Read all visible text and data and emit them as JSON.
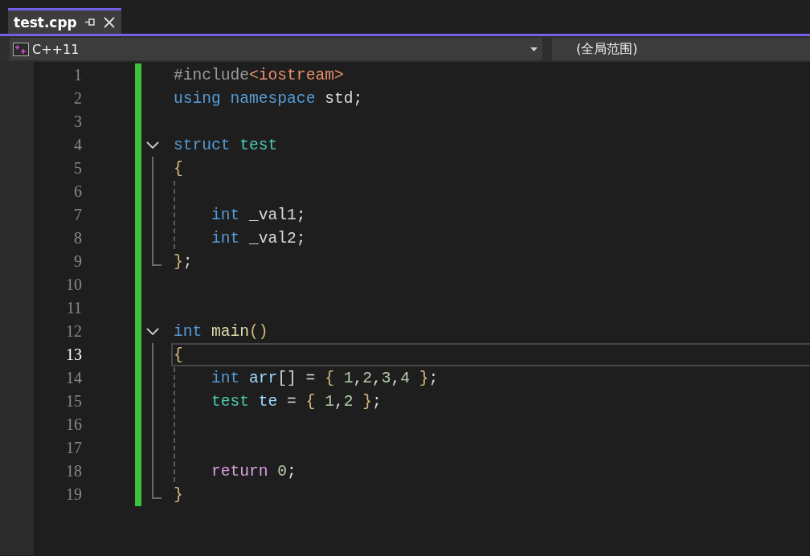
{
  "tabs": [
    {
      "label": "test.cpp",
      "selected": true
    }
  ],
  "nav_bar": {
    "project": "C++11",
    "scope": "(全局范围)"
  },
  "lines": [
    {
      "number": "1",
      "tokens": [
        {
          "text": "#include",
          "kind": "preprocessor"
        },
        {
          "text": "<iostream>",
          "kind": "string"
        }
      ]
    },
    {
      "number": "2",
      "tokens": [
        {
          "text": "using ",
          "kind": "keyword"
        },
        {
          "text": "namespace ",
          "kind": "keyword"
        },
        {
          "text": "std;",
          "kind": "plain"
        }
      ]
    },
    {
      "number": "3"
    },
    {
      "number": "4",
      "expanded": true,
      "tokens": [
        {
          "text": "struct ",
          "kind": "keyword"
        },
        {
          "text": "test",
          "kind": "type"
        }
      ],
      "children": [
        {
          "number": "5",
          "tokens": [
            {
              "text": "{",
              "kind": "brace"
            }
          ],
          "children": [
            {
              "number": "6"
            },
            {
              "number": "7",
              "tokens": [
                {
                  "text": "int ",
                  "kind": "keyword"
                },
                {
                  "text": "_val1;",
                  "kind": "plain"
                }
              ]
            },
            {
              "number": "8",
              "tokens": [
                {
                  "text": "int ",
                  "kind": "keyword"
                },
                {
                  "text": "_val2;",
                  "kind": "plain"
                }
              ]
            }
          ]
        },
        {
          "number": "9",
          "tokens": [
            {
              "text": "}",
              "kind": "brace"
            },
            {
              "text": ";",
              "kind": "plain"
            }
          ]
        }
      ]
    },
    {
      "number": "10"
    },
    {
      "number": "11"
    },
    {
      "number": "12",
      "expanded": true,
      "tokens": [
        {
          "text": "int ",
          "kind": "keyword"
        },
        {
          "text": "main",
          "kind": "function"
        },
        {
          "text": "()",
          "kind": "brace"
        }
      ],
      "children": [
        {
          "number": "13",
          "current": true,
          "tokens": [
            {
              "text": "{",
              "kind": "brace"
            }
          ],
          "children": [
            {
              "number": "14",
              "tokens": [
                {
                  "text": "int ",
                  "kind": "keyword"
                },
                {
                  "text": "arr",
                  "kind": "variable"
                },
                {
                  "text": "[] = ",
                  "kind": "plain"
                },
                {
                  "text": "{ ",
                  "kind": "brace"
                },
                {
                  "text": "1",
                  "kind": "number"
                },
                {
                  "text": ",",
                  "kind": "plain"
                },
                {
                  "text": "2",
                  "kind": "number"
                },
                {
                  "text": ",",
                  "kind": "plain"
                },
                {
                  "text": "3",
                  "kind": "number"
                },
                {
                  "text": ",",
                  "kind": "plain"
                },
                {
                  "text": "4 ",
                  "kind": "number"
                },
                {
                  "text": "}",
                  "kind": "brace"
                },
                {
                  "text": ";",
                  "kind": "plain"
                }
              ]
            },
            {
              "number": "15",
              "tokens": [
                {
                  "text": "test ",
                  "kind": "type"
                },
                {
                  "text": "te",
                  "kind": "variable"
                },
                {
                  "text": " = ",
                  "kind": "plain"
                },
                {
                  "text": "{ ",
                  "kind": "brace"
                },
                {
                  "text": "1",
                  "kind": "number"
                },
                {
                  "text": ",",
                  "kind": "plain"
                },
                {
                  "text": "2 ",
                  "kind": "number"
                },
                {
                  "text": "}",
                  "kind": "brace"
                },
                {
                  "text": ";",
                  "kind": "plain"
                }
              ]
            },
            {
              "number": "16"
            },
            {
              "number": "17"
            },
            {
              "number": "18",
              "tokens": [
                {
                  "text": "return ",
                  "kind": "control"
                },
                {
                  "text": "0",
                  "kind": "number"
                },
                {
                  "text": ";",
                  "kind": "plain"
                }
              ]
            }
          ]
        },
        {
          "number": "19",
          "tokens": [
            {
              "text": "}",
              "kind": "brace"
            }
          ]
        }
      ]
    }
  ]
}
